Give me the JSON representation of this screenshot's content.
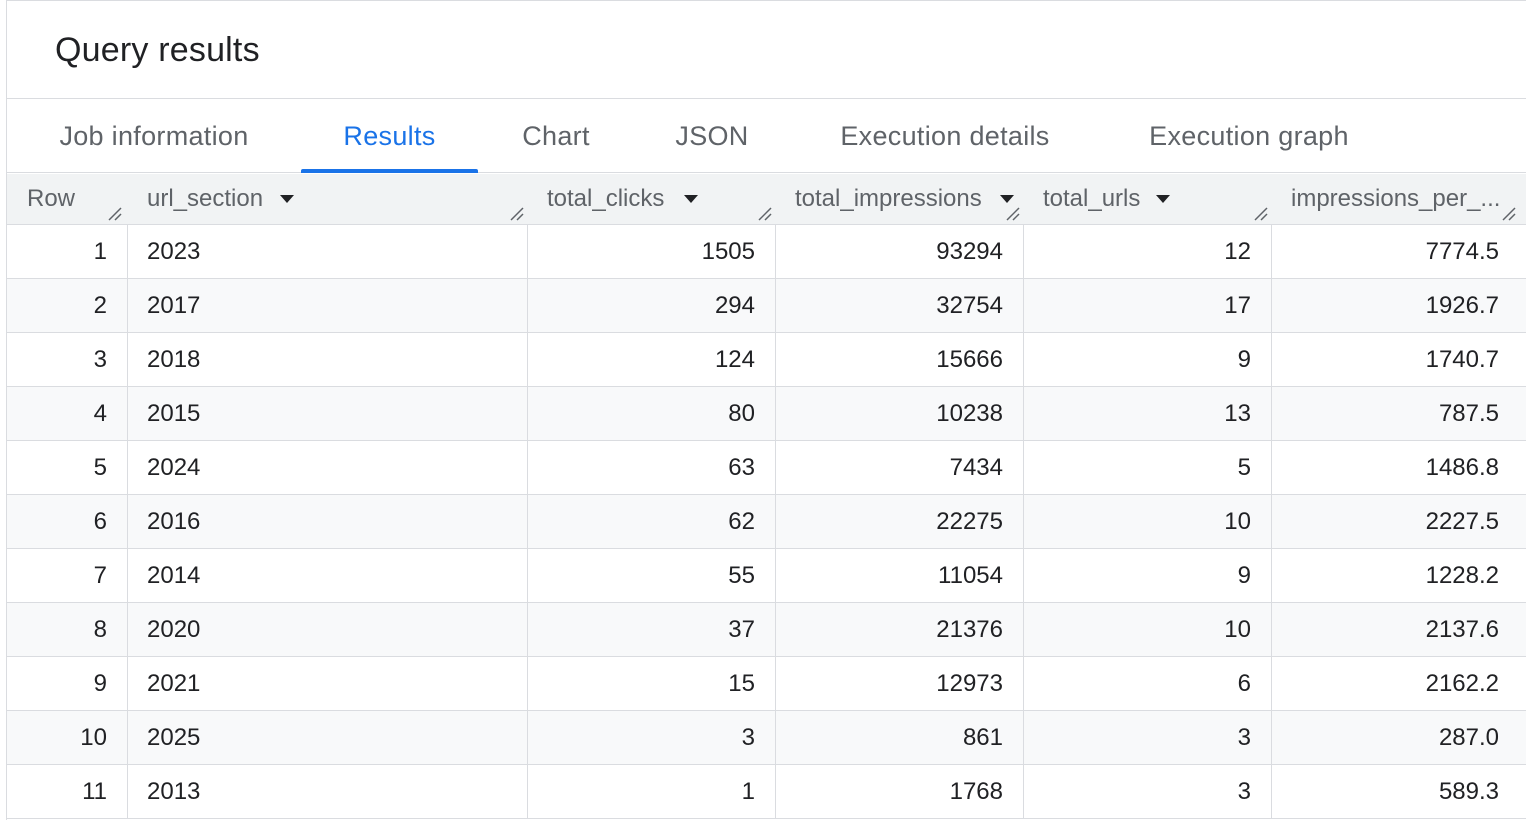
{
  "panel": {
    "title": "Query results"
  },
  "tabs": [
    {
      "label": "Job information",
      "active": false
    },
    {
      "label": "Results",
      "active": true
    },
    {
      "label": "Chart",
      "active": false
    },
    {
      "label": "JSON",
      "active": false
    },
    {
      "label": "Execution details",
      "active": false
    },
    {
      "label": "Execution graph",
      "active": false
    }
  ],
  "columns": [
    {
      "label": "Row",
      "sortable": false
    },
    {
      "label": "url_section",
      "sortable": true
    },
    {
      "label": "total_clicks",
      "sortable": true
    },
    {
      "label": "total_impressions",
      "sortable": true
    },
    {
      "label": "total_urls",
      "sortable": true
    },
    {
      "label": "impressions_per_...",
      "sortable": false
    }
  ],
  "rows": [
    [
      "1",
      "2023",
      "1505",
      "93294",
      "12",
      "7774.5"
    ],
    [
      "2",
      "2017",
      "294",
      "32754",
      "17",
      "1926.7"
    ],
    [
      "3",
      "2018",
      "124",
      "15666",
      "9",
      "1740.7"
    ],
    [
      "4",
      "2015",
      "80",
      "10238",
      "13",
      "787.5"
    ],
    [
      "5",
      "2024",
      "63",
      "7434",
      "5",
      "1486.8"
    ],
    [
      "6",
      "2016",
      "62",
      "22275",
      "10",
      "2227.5"
    ],
    [
      "7",
      "2014",
      "55",
      "11054",
      "9",
      "1228.2"
    ],
    [
      "8",
      "2020",
      "37",
      "21376",
      "10",
      "2137.6"
    ],
    [
      "9",
      "2021",
      "15",
      "12973",
      "6",
      "2162.2"
    ],
    [
      "10",
      "2025",
      "3",
      "861",
      "3",
      "287.0"
    ],
    [
      "11",
      "2013",
      "1",
      "1768",
      "3",
      "589.3"
    ]
  ],
  "icons": {
    "sort": "sort-desc-icon",
    "resize": "column-resize-icon"
  },
  "colors": {
    "accent": "#1a73e8",
    "header_bg": "#f1f3f4",
    "alt_row_bg": "#f8f9fa",
    "border": "#dadce0"
  }
}
